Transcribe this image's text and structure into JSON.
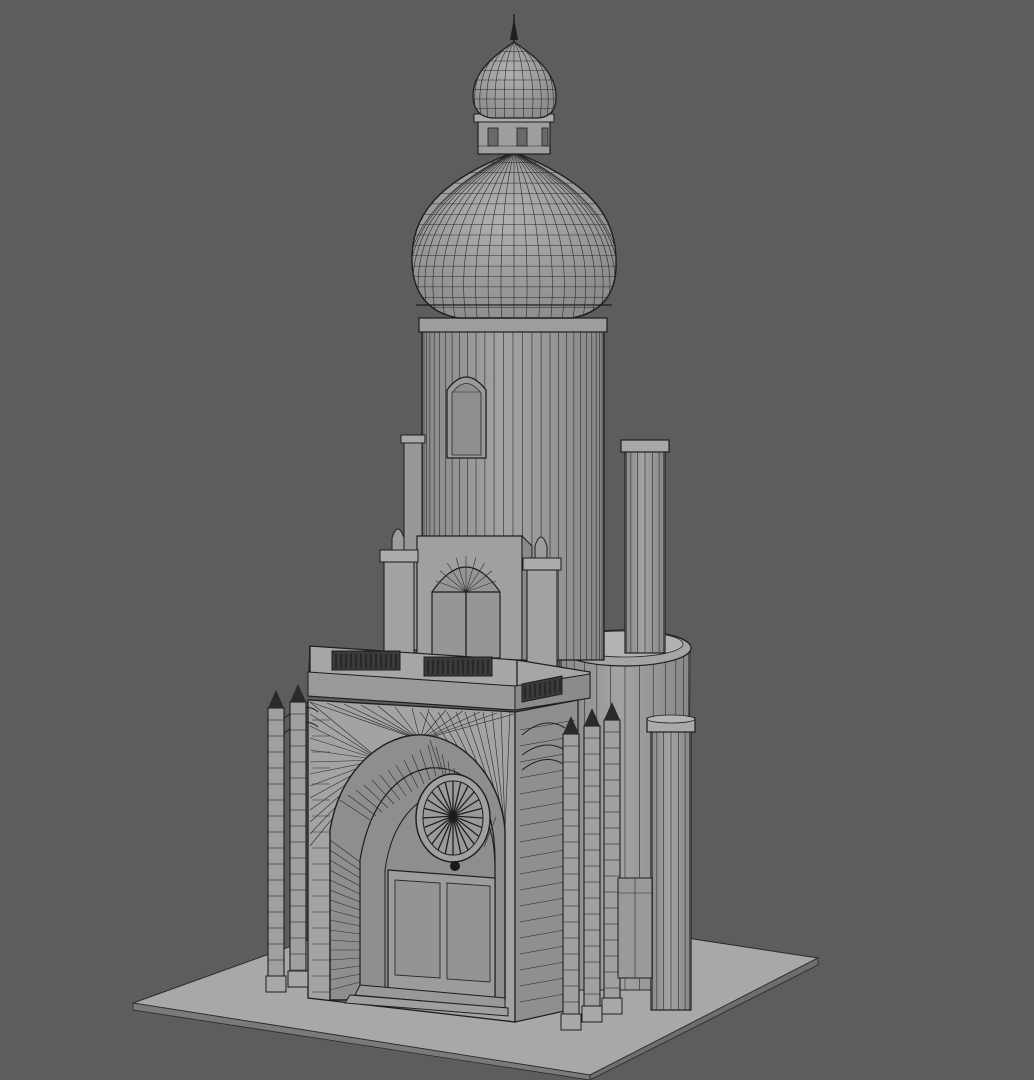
{
  "viewport": {
    "background": "#5d5d5d",
    "render_mode": "wireframe-on-shaded",
    "model": {
      "surface_color": "#9a9a9a",
      "wire_color": "#2a2a2a",
      "parts": [
        "onion-dome",
        "drum-tower",
        "tall-chimney",
        "short-chimney",
        "balcony",
        "balustrade",
        "arched-portal",
        "rose-window",
        "portal-doors",
        "gothic-pinnacles",
        "ground-slab"
      ]
    }
  }
}
